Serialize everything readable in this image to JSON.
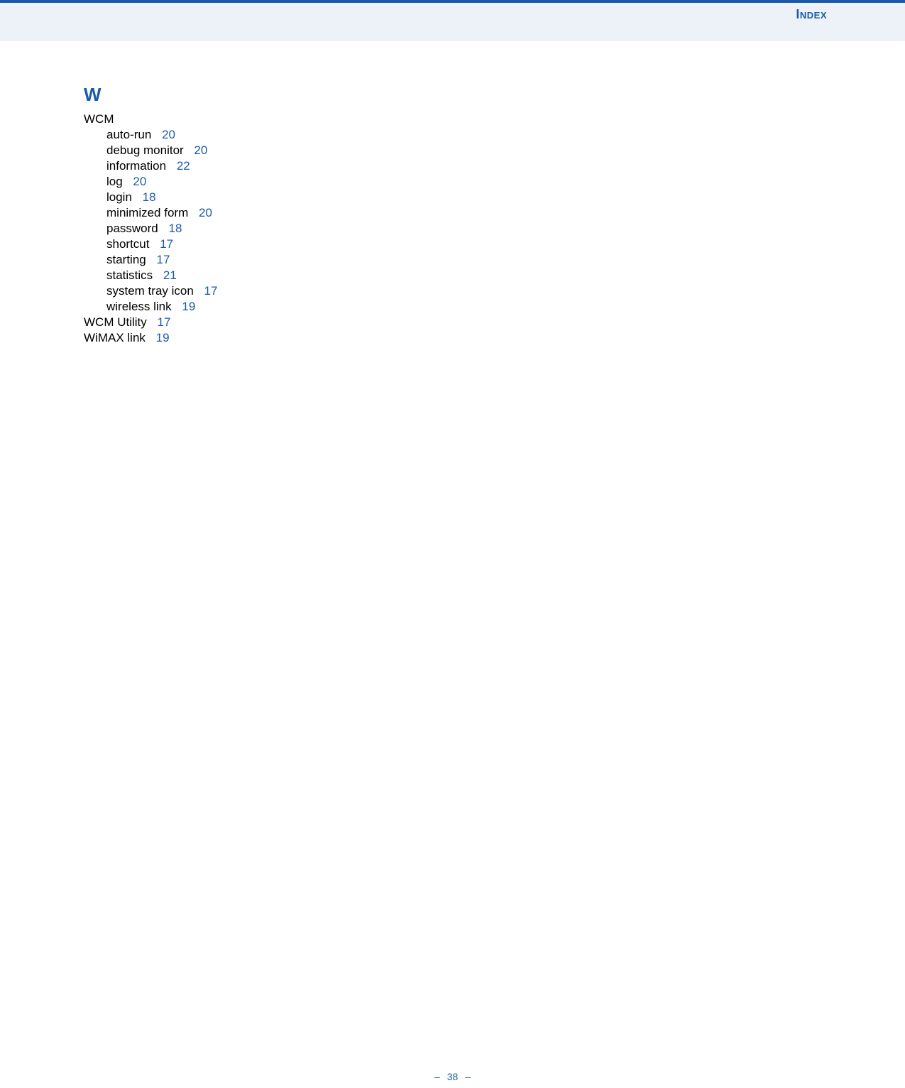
{
  "header": {
    "title": "Index"
  },
  "index": {
    "letter": "W",
    "entries": [
      {
        "term": "WCM",
        "page": "",
        "sub": [
          {
            "term": "auto-run",
            "page": "20"
          },
          {
            "term": "debug monitor",
            "page": "20"
          },
          {
            "term": "information",
            "page": "22"
          },
          {
            "term": "log",
            "page": "20"
          },
          {
            "term": "login",
            "page": "18"
          },
          {
            "term": "minimized form",
            "page": "20"
          },
          {
            "term": "password",
            "page": "18"
          },
          {
            "term": "shortcut",
            "page": "17"
          },
          {
            "term": "starting",
            "page": "17"
          },
          {
            "term": "statistics",
            "page": "21"
          },
          {
            "term": "system tray icon",
            "page": "17"
          },
          {
            "term": "wireless link",
            "page": "19"
          }
        ]
      },
      {
        "term": "WCM Utility",
        "page": "17",
        "sub": []
      },
      {
        "term": "WiMAX link",
        "page": "19",
        "sub": []
      }
    ]
  },
  "footer": {
    "dash_left": "–",
    "page_number": "38",
    "dash_right": "–"
  }
}
